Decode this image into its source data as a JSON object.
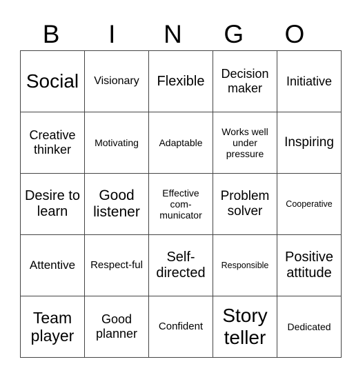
{
  "header": [
    "B",
    "I",
    "N",
    "G",
    "O"
  ],
  "rows": [
    [
      "Social",
      "Visionary",
      "Flexible",
      "Decision maker",
      "Initiative"
    ],
    [
      "Creative thinker",
      "Motivating",
      "Adaptable",
      "Works well under pressure",
      "Inspiring"
    ],
    [
      "Desire to learn",
      "Good listener",
      "Effective com-municator",
      "Problem solver",
      "Cooperative"
    ],
    [
      "Attentive",
      "Respect-ful",
      "Self-directed",
      "Responsible",
      "Positive attitude"
    ],
    [
      "Team player",
      "Good planner",
      "Confident",
      "Story teller",
      "Dedicated"
    ]
  ]
}
